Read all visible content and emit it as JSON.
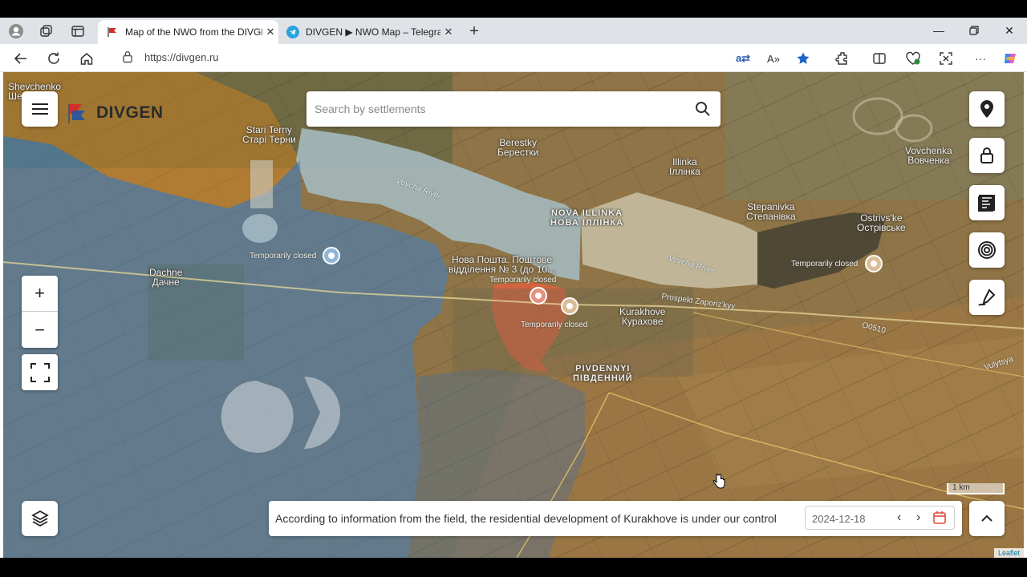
{
  "browser": {
    "tabs": [
      {
        "title": "Map of the NWO from the DIVGE",
        "active": true
      },
      {
        "title": "DIVGEN ▶ NWO Map – Telegram",
        "active": false
      }
    ],
    "url": "https://divgen.ru"
  },
  "app": {
    "brand": "DIVGEN",
    "search_placeholder": "Search by settlements",
    "news": "According to information from the field, the residential development of Kurakhove is under our control",
    "date": "2024-12-18",
    "scale": "1 km",
    "attribution": "Leaflet",
    "colors": {
      "ukraine_zone": "#3e7fc4",
      "russia_zone": "#ff5a3c",
      "contested_zone": "#e08a1a"
    }
  },
  "map": {
    "places": {
      "shevchenko": {
        "en": "Shevchenko",
        "ua": "Шевченко"
      },
      "stari_terny": {
        "en": "Stari Terny",
        "ua": "Старі Терни"
      },
      "berestky": {
        "en": "Berestky",
        "ua": "Берестки"
      },
      "illinka": {
        "en": "Illinka",
        "ua": "Іллінка"
      },
      "vovchenka": {
        "en": "Vovchenka",
        "ua": "Вовченка"
      },
      "nova_illinka": {
        "en": "NOVA ILLINKA",
        "ua": "НОВА ІЛЛІНКА"
      },
      "stepanivka": {
        "en": "Stepanivka",
        "ua": "Степанівка"
      },
      "ostrivske": {
        "en": "Ostrivs'ke",
        "ua": "Острівське"
      },
      "dachne": {
        "en": "Dachne",
        "ua": "Дачне"
      },
      "kurakhove": {
        "en": "Kurakhove",
        "ua": "Курахове"
      },
      "pivdennyi": {
        "en": "PIVDENNYI",
        "ua": "ПІВДЕННИЙ"
      }
    },
    "poi": {
      "nova_poshta_1": "Нова Пошта. Поштове",
      "nova_poshta_2": "відділення № 3 (до 10...",
      "closed_label": "Temporarily closed"
    },
    "roads": {
      "prospekt": "Prospekt Zaporiz'kyy",
      "route": "O0510",
      "vulytsya": "Vulytsya"
    },
    "river": "Vovcha River"
  }
}
